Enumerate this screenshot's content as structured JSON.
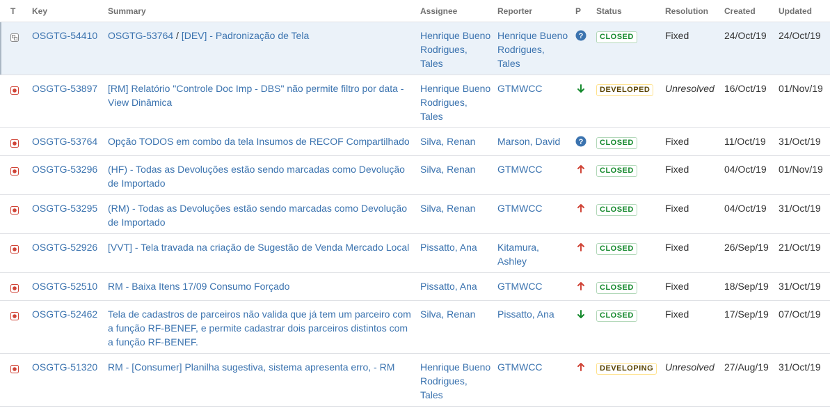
{
  "columns": {
    "t": "T",
    "key": "Key",
    "summary": "Summary",
    "assignee": "Assignee",
    "reporter": "Reporter",
    "p": "P",
    "status": "Status",
    "resolution": "Resolution",
    "created": "Created",
    "updated": "Updated"
  },
  "colors": {
    "link": "#3b73af",
    "bug_red": "#d04437",
    "priority_up": "#d04437",
    "priority_down": "#14892c",
    "priority_unknown": "#3b73af",
    "status_done": "#14892c",
    "status_progress": "#594300",
    "selected_row": "#ebf2f9"
  },
  "rows": [
    {
      "type": "subtask-icon",
      "key": "OSGTG-54410",
      "parent": "OSGTG-53764",
      "separator": " / ",
      "summary": "[DEV] - Padronização de Tela",
      "assignee": "Henrique Bueno Rodrigues, Tales",
      "reporter": "Henrique Bueno Rodrigues, Tales",
      "priority": "unknown-priority-icon",
      "status": "CLOSED",
      "status_style": "done",
      "resolution": "Fixed",
      "created": "24/Oct/19",
      "updated": "24/Oct/19"
    },
    {
      "type": "bug-icon",
      "key": "OSGTG-53897",
      "summary": "[RM] Relatório \"Controle Doc Imp - DBS\" não permite filtro por data - View Dinâmica",
      "assignee": "Henrique Bueno Rodrigues, Tales",
      "reporter": "GTMWCC",
      "priority": "arrow-down-icon",
      "status": "DEVELOPED",
      "status_style": "progress",
      "resolution": "Unresolved",
      "created": "16/Oct/19",
      "updated": "01/Nov/19"
    },
    {
      "type": "bug-icon",
      "key": "OSGTG-53764",
      "summary": "Opção TODOS em combo da tela Insumos de RECOF Compartilhado",
      "assignee": "Silva, Renan",
      "reporter": "Marson, David",
      "priority": "unknown-priority-icon",
      "status": "CLOSED",
      "status_style": "done",
      "resolution": "Fixed",
      "created": "11/Oct/19",
      "updated": "31/Oct/19"
    },
    {
      "type": "bug-icon",
      "key": "OSGTG-53296",
      "summary": "(HF) - Todas as Devoluções estão sendo marcadas como Devolução de Importado",
      "assignee": "Silva, Renan",
      "reporter": "GTMWCC",
      "priority": "arrow-up-icon",
      "status": "CLOSED",
      "status_style": "done",
      "resolution": "Fixed",
      "created": "04/Oct/19",
      "updated": "01/Nov/19"
    },
    {
      "type": "bug-icon",
      "key": "OSGTG-53295",
      "summary": "(RM) - Todas as Devoluções estão sendo marcadas como Devolução de Importado",
      "assignee": "Silva, Renan",
      "reporter": "GTMWCC",
      "priority": "arrow-up-icon",
      "status": "CLOSED",
      "status_style": "done",
      "resolution": "Fixed",
      "created": "04/Oct/19",
      "updated": "31/Oct/19"
    },
    {
      "type": "bug-icon",
      "key": "OSGTG-52926",
      "summary": "[VVT] - Tela travada na criação de Sugestão de Venda Mercado Local",
      "assignee": "Pissatto, Ana",
      "reporter": "Kitamura, Ashley",
      "priority": "arrow-up-icon",
      "status": "CLOSED",
      "status_style": "done",
      "resolution": "Fixed",
      "created": "26/Sep/19",
      "updated": "21/Oct/19"
    },
    {
      "type": "bug-icon",
      "key": "OSGTG-52510",
      "summary": "RM - Baixa Itens 17/09 Consumo Forçado",
      "assignee": "Pissatto, Ana",
      "reporter": "GTMWCC",
      "priority": "arrow-up-icon",
      "status": "CLOSED",
      "status_style": "done",
      "resolution": "Fixed",
      "created": "18/Sep/19",
      "updated": "31/Oct/19"
    },
    {
      "type": "bug-icon",
      "key": "OSGTG-52462",
      "summary": "Tela de cadastros de parceiros não valida que já tem um parceiro com a função RF-BENEF, e permite cadastrar dois parceiros distintos com a função RF-BENEF.",
      "assignee": "Silva, Renan",
      "reporter": "Pissatto, Ana",
      "priority": "arrow-down-icon",
      "status": "CLOSED",
      "status_style": "done",
      "resolution": "Fixed",
      "created": "17/Sep/19",
      "updated": "07/Oct/19"
    },
    {
      "type": "bug-icon",
      "key": "OSGTG-51320",
      "summary": "RM - [Consumer] Planilha sugestiva, sistema apresenta erro, - RM",
      "assignee": "Henrique Bueno Rodrigues, Tales",
      "reporter": "GTMWCC",
      "priority": "arrow-up-icon",
      "status": "DEVELOPING",
      "status_style": "progress",
      "resolution": "Unresolved",
      "created": "27/Aug/19",
      "updated": "31/Oct/19"
    }
  ]
}
